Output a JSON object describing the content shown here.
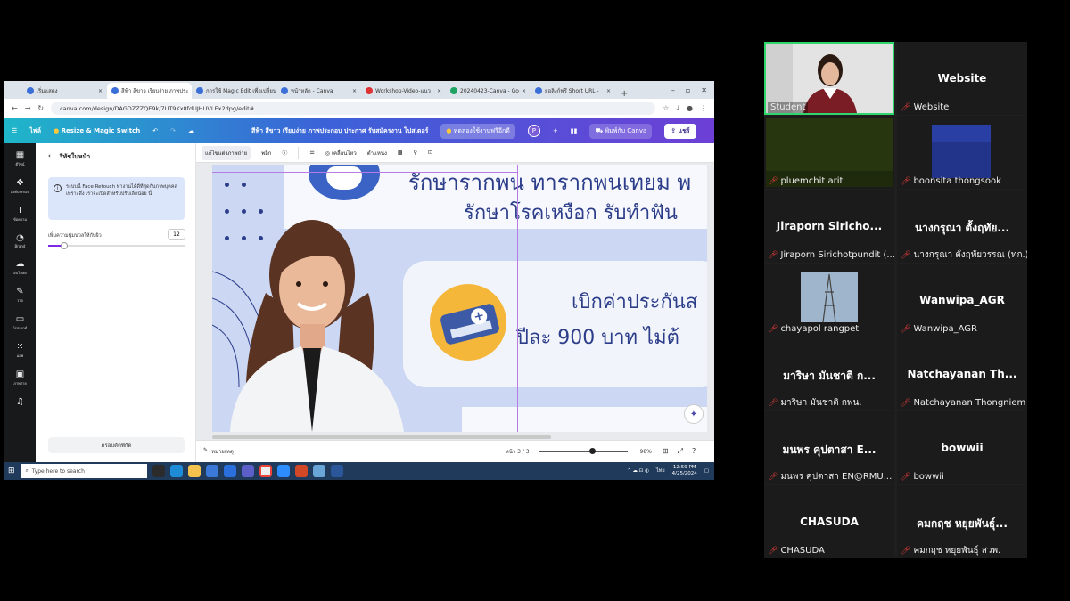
{
  "browser": {
    "tabs": [
      {
        "label": "เริ่มแสดง",
        "active": false
      },
      {
        "label": "สีฟ้า สีขาว เรียบง่าย ภาพประ",
        "active": true
      },
      {
        "label": "การใช้ Magic Edit เพื่อเปลี่ยน",
        "active": false
      },
      {
        "label": "หน้าหลัก - Canva",
        "active": false
      },
      {
        "label": "Workshop-Video-แนว",
        "active": false
      },
      {
        "label": "20240423-Canva - Go",
        "active": false
      },
      {
        "label": "ย่อลิงก์ฟรี Short URL -",
        "active": false
      }
    ],
    "url": "canva.com/design/DAGDZZZQE9k/7UT9Kx8fdUJHUVLEx2dpg/edit#"
  },
  "canva": {
    "file_menu": "ไฟล์",
    "resize_label": "Resize & Magic Switch",
    "doc_title": "สีฟ้า สีขาว เรียบง่าย ภาพประกอบ ประกาศ รับสมัครงาน โปสเตอร์",
    "trial_label": "ทดลองใช้งานฟรีอีกดี",
    "avatar_letter": "P",
    "print_label": "พิมพ์กับ Canva",
    "share_label": "แชร์"
  },
  "rail": [
    {
      "label": "ดีไซน์",
      "icon": "layout-icon"
    },
    {
      "label": "องค์ประกอบ",
      "icon": "elements-icon"
    },
    {
      "label": "ข้อความ",
      "icon": "text-icon"
    },
    {
      "label": "Brand",
      "icon": "brand-icon"
    },
    {
      "label": "อัปโหลด",
      "icon": "upload-icon"
    },
    {
      "label": "วาด",
      "icon": "draw-icon"
    },
    {
      "label": "โปรเจกต์",
      "icon": "folder-icon"
    },
    {
      "label": "แอพ",
      "icon": "apps-icon"
    },
    {
      "label": "ภาพถ่าย",
      "icon": "photos-icon"
    },
    {
      "label": "",
      "icon": "audio-icon"
    }
  ],
  "panel": {
    "title": "รีทัชใบหน้า",
    "info_text": "ระบบนี้ Face Retouch ทำงานได้ดีที่สุดกับภาพบุคคลเพราะสิ่ง เราจะเปิดสำหรับปรับเล็กน้อย นี้",
    "slider_label": "เพิ่มความนุ่มนวลให้กับผิว",
    "slider_value": "12",
    "slider_fraction": 0.12,
    "button_label": "ครอบตัดพิกัด"
  },
  "context_bar": {
    "edit_photo": "แก้ไขแต่งภาพถ่าย",
    "flip": "พลิก",
    "animate": "เคลื่อนไหว",
    "position": "ตำแหน่ง"
  },
  "design": {
    "headline_1": "รักษารากพน ทารากพนเทยม พ",
    "headline_2": "รักษาโรคเหงือก รับทำฟัน",
    "claim_1": "เบิกค่าประกันส",
    "claim_2": "ปีละ 900 บาท ไม่ต้"
  },
  "footer": {
    "notes": "หมายเหตุ",
    "page": "หน้า 3 / 3",
    "zoom": "98%",
    "zoom_fraction": 0.6
  },
  "taskbar": {
    "search_placeholder": "Type here to search",
    "lang": "ไทย",
    "time": "12:59 PM",
    "date": "4/25/2024"
  },
  "participants": [
    {
      "display": "",
      "label": "Student",
      "video": true,
      "muted": false,
      "active": true
    },
    {
      "display": "Website",
      "label": "Website",
      "video": false,
      "muted": true
    },
    {
      "display": "",
      "label": "pluemchit arit",
      "video": true,
      "muted": true
    },
    {
      "display": "",
      "label": "boonsita thongsook",
      "video": true,
      "muted": true
    },
    {
      "display": "Jiraporn  Siricho...",
      "label": "Jiraporn Sirichotpundit (...",
      "video": false,
      "muted": true
    },
    {
      "display": "นางกรุณา  ตั้งฤทัย...",
      "label": "นางกรุณา ตั้งฤทัยวรรณ (ทก.)",
      "video": false,
      "muted": true
    },
    {
      "display": "",
      "label": "chayapol rangpet",
      "video": true,
      "muted": true
    },
    {
      "display": "Wanwipa_AGR",
      "label": "Wanwipa_AGR",
      "video": false,
      "muted": true
    },
    {
      "display": "มาริษา  มันชาติ ก...",
      "label": "มาริษา มันชาติ กพน.",
      "video": false,
      "muted": true
    },
    {
      "display": "Natchayanan  Th...",
      "label": "Natchayanan Thongniem",
      "video": false,
      "muted": true
    },
    {
      "display": "มนพร  คุปตาสา E...",
      "label": "มนพร  คุปตาสา EN@RMU...",
      "video": false,
      "muted": true
    },
    {
      "display": "bowwii",
      "label": "bowwii",
      "video": false,
      "muted": true
    },
    {
      "display": "CHASUDA",
      "label": "CHASUDA",
      "video": false,
      "muted": true
    },
    {
      "display": "คมกฤช  หยุยพันธุ์...",
      "label": "คมกฤช หยุยพันธุ์ สวพ.",
      "video": false,
      "muted": true
    }
  ],
  "colors": {
    "accent_purple": "#7d2ae8",
    "design_navy": "#2c3d8a",
    "active_speaker": "#2fd66a",
    "muted_mic": "#e23b3b"
  }
}
